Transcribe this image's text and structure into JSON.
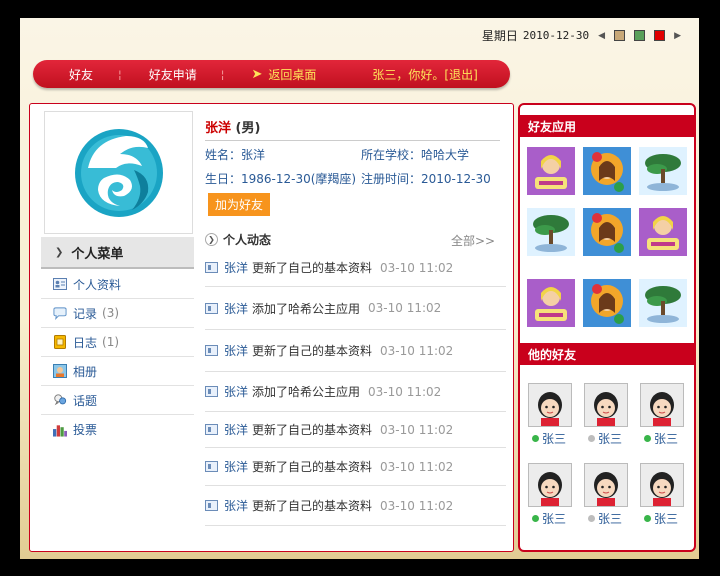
{
  "header": {
    "weekday": "星期日",
    "date": "2010-12-30",
    "prev_arrow": "◀",
    "next_arrow": "▶",
    "theme_colors": [
      "#c8a878",
      "#5aa05a",
      "#e00000"
    ]
  },
  "nav": {
    "items": [
      "好友",
      "好友申请"
    ],
    "back_label": "返回桌面",
    "greeting": "张三，你好。",
    "logout": "[退出]"
  },
  "profile": {
    "name": "张洋",
    "gender": "(男)",
    "fields": {
      "name_line": "姓名：张洋",
      "school_line": "所在学校：哈哈大学",
      "birthday_line": "生日：1986-12-30(摩羯座)",
      "register_line": "注册时间：2010-12-30"
    },
    "add_friend_label": "加为好友"
  },
  "menu": {
    "title": "个人菜单",
    "items": [
      {
        "label": "个人资料",
        "count": "",
        "icon": "profile-card-icon"
      },
      {
        "label": "记录",
        "count": "(3)",
        "icon": "speech-bubble-icon"
      },
      {
        "label": "日志",
        "count": "(1)",
        "icon": "lock-note-icon"
      },
      {
        "label": "相册",
        "count": "",
        "icon": "photo-icon"
      },
      {
        "label": "话题",
        "count": "",
        "icon": "topic-icon"
      },
      {
        "label": "投票",
        "count": "",
        "icon": "bar-chart-icon"
      }
    ]
  },
  "feed": {
    "title": "个人动态",
    "all_label": "全部>>",
    "items": [
      {
        "user": "张洋",
        "action": "更新了自己的基本资料",
        "time": "03-10 11:02"
      },
      {
        "user": "张洋",
        "action": "添加了哈希公主应用",
        "time": "03-10 11:02"
      },
      {
        "user": "张洋",
        "action": "更新了自己的基本资料",
        "time": "03-10 11:02"
      },
      {
        "user": "张洋",
        "action": "添加了哈希公主应用",
        "time": "03-10 11:02"
      },
      {
        "user": "张洋",
        "action": "更新了自己的基本资料",
        "time": "03-10 11:02"
      },
      {
        "user": "张洋",
        "action": "更新了自己的基本资料",
        "time": "03-10 11:02"
      },
      {
        "user": "张洋",
        "action": "更新了自己的基本资料",
        "time": "03-10 11:02"
      }
    ]
  },
  "side": {
    "apps_title": "好友应用",
    "friends_title": "他的好友",
    "apps": [
      "princess-game-icon",
      "flower-girl-icon",
      "bonsai-tree-icon",
      "bonsai-tree-icon",
      "flower-girl-icon",
      "princess-game-icon",
      "princess-game-icon",
      "flower-girl-icon",
      "bonsai-tree-icon"
    ],
    "friends": [
      {
        "name": "张三",
        "online": true
      },
      {
        "name": "张三",
        "online": false
      },
      {
        "name": "张三",
        "online": true
      },
      {
        "name": "张三",
        "online": true
      },
      {
        "name": "张三",
        "online": false
      },
      {
        "name": "张三",
        "online": true
      }
    ]
  }
}
